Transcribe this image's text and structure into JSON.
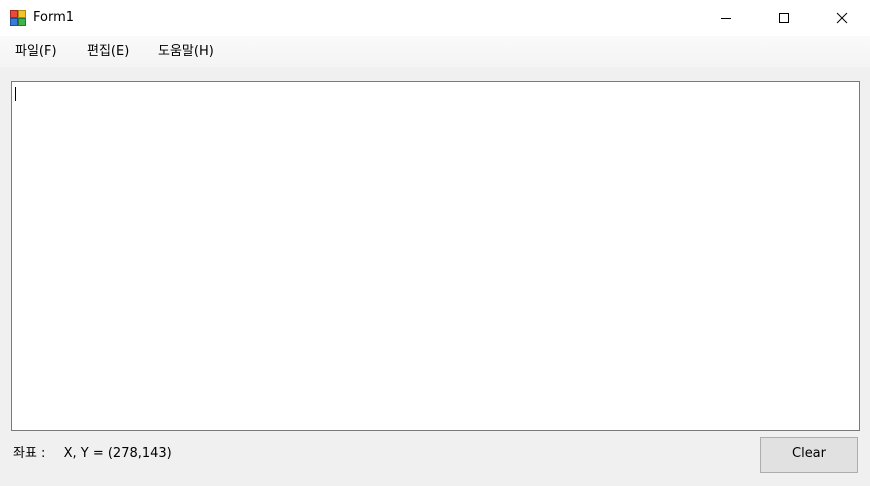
{
  "window": {
    "title": "Form1",
    "icon": "winforms-app-icon"
  },
  "caption_buttons": {
    "minimize_icon": "minimize-icon",
    "maximize_icon": "maximize-icon",
    "close_icon": "close-icon"
  },
  "menu": {
    "items": [
      {
        "label": "파일(F)"
      },
      {
        "label": "편집(E)"
      },
      {
        "label": "도움말(H)"
      }
    ]
  },
  "editor": {
    "value": ""
  },
  "status": {
    "label": "좌표 :",
    "value": "X, Y = (278,143)"
  },
  "buttons": {
    "clear_label": "Clear"
  },
  "colors": {
    "window_bg": "#f0f0f0",
    "titlebar_bg": "#ffffff",
    "textarea_border": "#7a7a7a",
    "button_bg": "#e1e1e1",
    "button_border": "#adadad"
  }
}
